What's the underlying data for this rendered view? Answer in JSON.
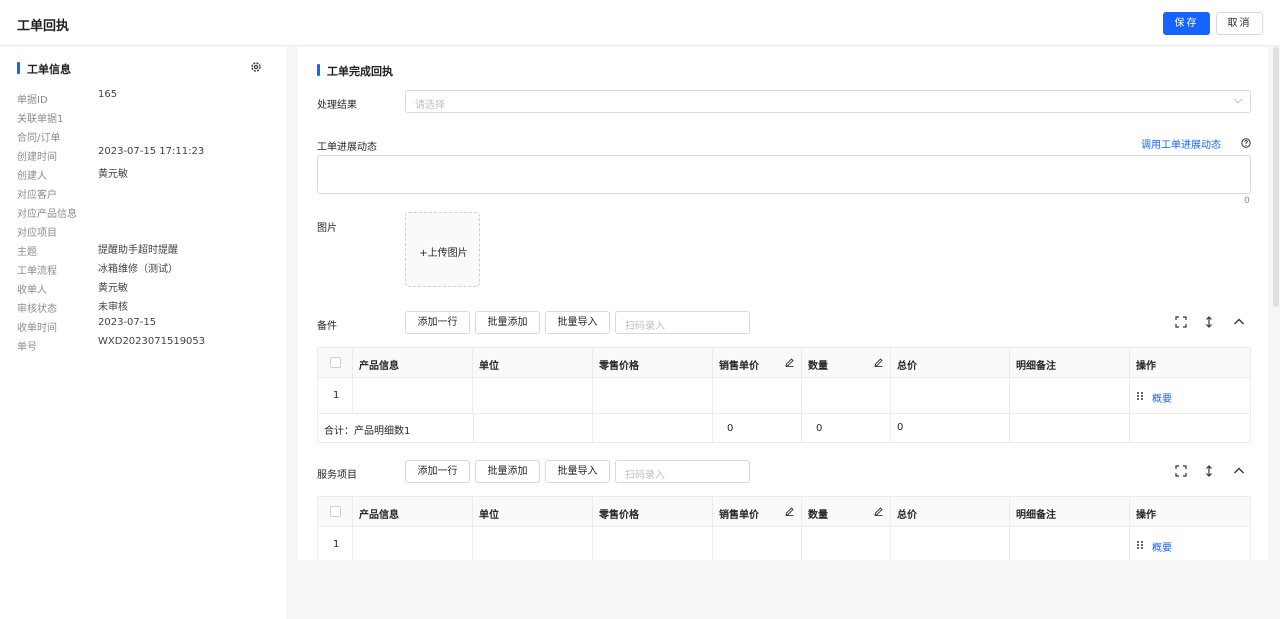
{
  "header": {
    "title": "工单回执",
    "save_label": "保存",
    "cancel_label": "取消"
  },
  "left": {
    "title": "工单信息",
    "gear_icon": "gear-icon",
    "rows": [
      {
        "key": "单据ID",
        "value": "165"
      },
      {
        "key": "关联单据1",
        "value": ""
      },
      {
        "key": "合同/订单",
        "value": ""
      },
      {
        "key": "创建时间",
        "value": "2023-07-15 17:11:23"
      },
      {
        "key": "创建人",
        "value": "黄元敏"
      },
      {
        "key": "对应客户",
        "value": ""
      },
      {
        "key": "对应产品信息",
        "value": ""
      },
      {
        "key": "对应项目",
        "value": ""
      },
      {
        "key": "主题",
        "value": "提醒助手超时提醒"
      },
      {
        "key": "工单流程",
        "value": "冰箱维修（测试）"
      },
      {
        "key": "收单人",
        "value": "黄元敏"
      },
      {
        "key": "审核状态",
        "value": "未审核"
      },
      {
        "key": "收单时间",
        "value": "2023-07-15"
      },
      {
        "key": "单号",
        "value": "WXD2023071519053"
      }
    ]
  },
  "main": {
    "title": "工单完成回执",
    "result_label": "处理结果",
    "result_placeholder": "请选择",
    "progress_label": "工单进展动态",
    "progress_link": "调用工单进展动态",
    "progress_count": "0",
    "image_label": "图片",
    "upload_label": "+上传图片",
    "sections": [
      {
        "label": "备件",
        "buttons": [
          "添加一行",
          "批量添加",
          "批量导入"
        ],
        "scan_placeholder": "扫码录入",
        "headers": [
          "产品信息",
          "单位",
          "零售价格",
          "销售单价",
          "数量",
          "总价",
          "明细备注",
          "操作"
        ],
        "row": {
          "index": "1",
          "action": "概要"
        },
        "total": {
          "label": "合计：产品明细数1",
          "sale": "0",
          "qty": "0",
          "total": "0"
        }
      },
      {
        "label": "服务项目",
        "buttons": [
          "添加一行",
          "批量添加",
          "批量导入"
        ],
        "scan_placeholder": "扫码录入",
        "headers": [
          "产品信息",
          "单位",
          "零售价格",
          "销售单价",
          "数量",
          "总价",
          "明细备注",
          "操作"
        ],
        "row": {
          "index": "1",
          "action": "概要"
        }
      }
    ]
  },
  "colors": {
    "accent": "#1664ff",
    "border": "#d9d9d9",
    "muted": "#8c8c8c"
  }
}
